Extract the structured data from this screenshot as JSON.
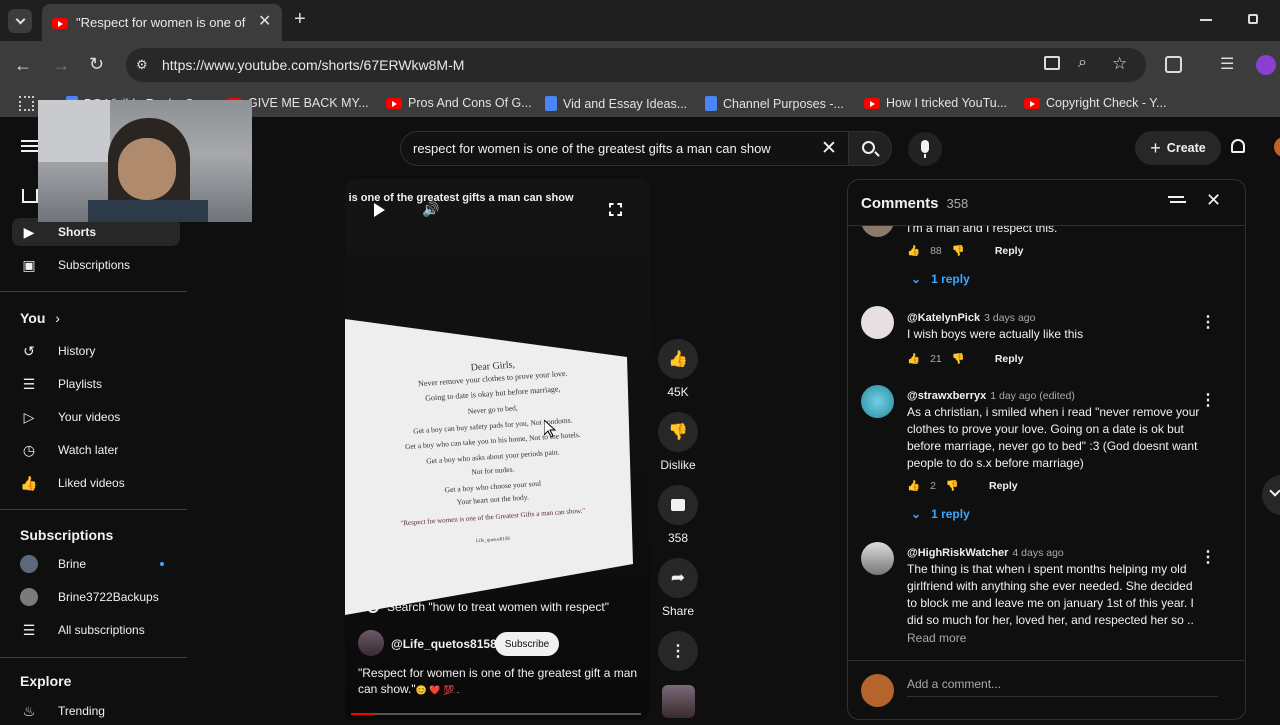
{
  "browser": {
    "tab_title": "\"Respect for women is one of t",
    "url": "https://www.youtube.com/shorts/67ERWkw8M-M",
    "bookmarks": [
      "BO Visible Realm Se...",
      "GIVE ME BACK MY...",
      "Pros And Cons Of G...",
      "Vid and Essay Ideas...",
      "Channel Purposes -...",
      "How I tricked YouTu...",
      "Copyright Check - Y..."
    ]
  },
  "header": {
    "search_query": "respect for women is one of the greatest gifts a man can show",
    "create_label": "Create"
  },
  "sidebar": {
    "shorts": "Shorts",
    "subscriptions": "Subscriptions",
    "you": "You",
    "you_items": [
      "History",
      "Playlists",
      "Your videos",
      "Watch later",
      "Liked videos"
    ],
    "subs_heading": "Subscriptions",
    "channels": [
      "Brine",
      "Brine3722Backups"
    ],
    "all_subs": "All subscriptions",
    "explore": "Explore",
    "trending": "Trending"
  },
  "video": {
    "overlay_title": "espect for women is one of the greatest gifts a man can show",
    "paper_lines": [
      "Dear Girls,",
      "Never remove your clothes to prove your love.",
      "Going to date is okay but before marriage,",
      "Never go to bed,",
      "Get a boy can buy safety pads for you, Not condoms.",
      "Get a boy who can take you to his home, Not to the hotels.",
      "Get a boy who asks about your periods pain.",
      "Not for nudes.",
      "Get a boy who choose your soul",
      "Your heart not the body.",
      "\"Respect for women is one of the Greatest Gifts a man can show.\"",
      "Life_quetos8158"
    ],
    "search_suggestion": "Search \"how to treat women with respect\"",
    "channel": "@Life_quetos8158",
    "subscribe": "Subscribe",
    "caption_line1": "\"Respect for women is one of the greatest gift a man",
    "caption_line2": "can show.\"",
    "caption_emoji": "😊 ❤️ 💯 .",
    "progress": 0.08
  },
  "actions": {
    "likes": "45K",
    "dislike": "Dislike",
    "comments": "358",
    "share": "Share"
  },
  "comments": {
    "title": "Comments",
    "count": "358",
    "items": [
      {
        "text": "I'm a man and I respect this.",
        "likes": "88",
        "reply": "Reply",
        "replies": "1 reply"
      },
      {
        "author": "@KatelynPick",
        "time": "3 days ago",
        "text": "I wish boys were actually like this",
        "likes": "21",
        "reply": "Reply"
      },
      {
        "author": "@strawxberryx",
        "time": "1 day ago (edited)",
        "lines": [
          "As a christian, i smiled when i read \"never remove your",
          "clothes to prove your love. Going on a date is ok but",
          "before marriage, never go to bed\" :3 (God doesnt want",
          "people to do s.x before marriage)"
        ],
        "likes": "2",
        "reply": "Reply",
        "replies": "1 reply"
      },
      {
        "author": "@HighRiskWatcher",
        "time": "4 days ago",
        "lines": [
          "The thing is that when i spent months helping my old",
          "girlfriend with anything she ever needed. She decided",
          "to block me and leave me on january 1st of this year. I",
          "did so much for her, loved her, and respected her so .."
        ],
        "read_more": "Read more"
      }
    ],
    "add_placeholder": "Add a comment..."
  }
}
